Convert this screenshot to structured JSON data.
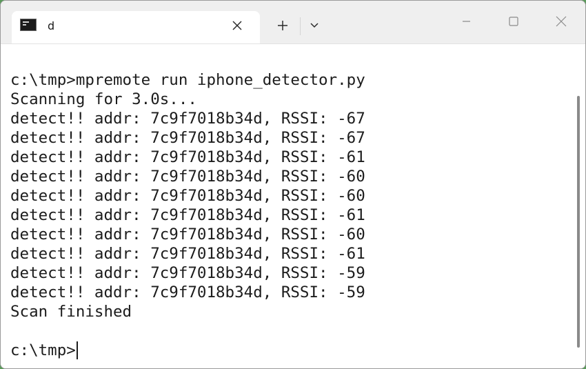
{
  "tab": {
    "title": "d",
    "icon": "terminal-icon"
  },
  "titlebar": {
    "new_tab_icon": "plus-icon",
    "dropdown_icon": "chevron-down-icon",
    "minimize_icon": "minimize-icon",
    "maximize_icon": "maximize-icon",
    "close_icon": "close-icon"
  },
  "terminal": {
    "lines": [
      "c:\\tmp>mpremote run iphone_detector.py",
      "Scanning for 3.0s...",
      "detect!! addr: 7c9f7018b34d, RSSI: -67",
      "detect!! addr: 7c9f7018b34d, RSSI: -67",
      "detect!! addr: 7c9f7018b34d, RSSI: -61",
      "detect!! addr: 7c9f7018b34d, RSSI: -60",
      "detect!! addr: 7c9f7018b34d, RSSI: -60",
      "detect!! addr: 7c9f7018b34d, RSSI: -61",
      "detect!! addr: 7c9f7018b34d, RSSI: -60",
      "detect!! addr: 7c9f7018b34d, RSSI: -61",
      "detect!! addr: 7c9f7018b34d, RSSI: -59",
      "detect!! addr: 7c9f7018b34d, RSSI: -59",
      "Scan finished"
    ],
    "prompt": "c:\\tmp>"
  }
}
